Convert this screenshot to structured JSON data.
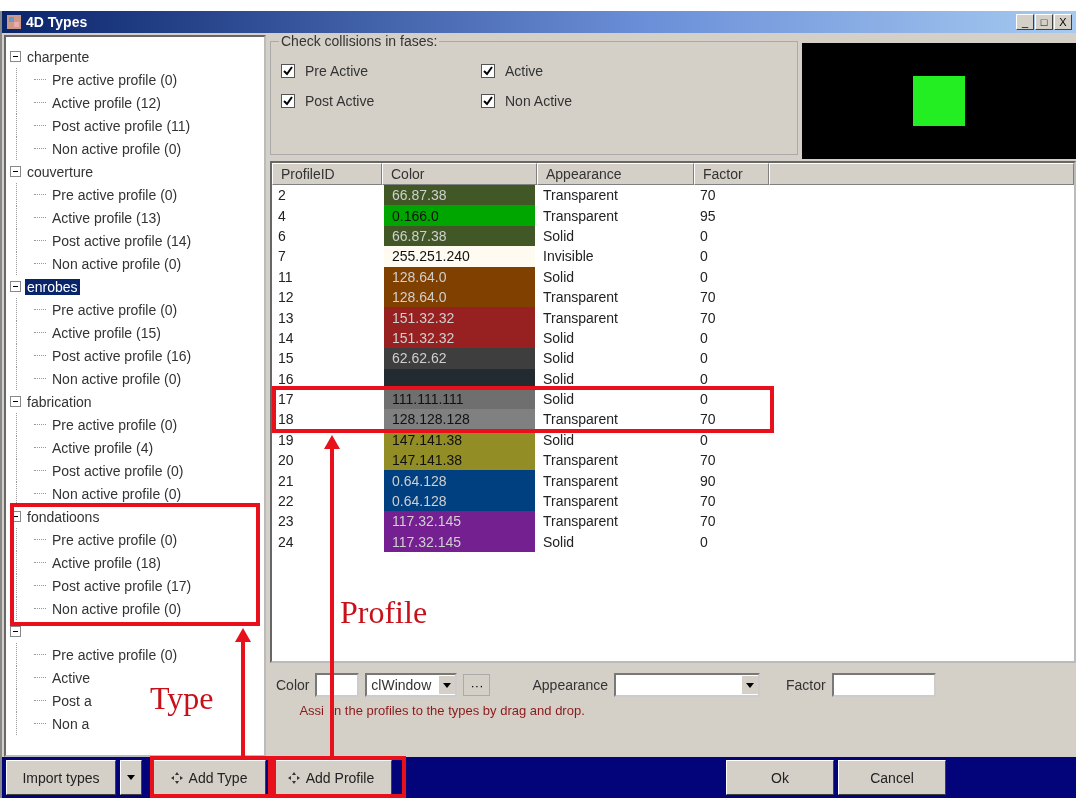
{
  "window": {
    "title": "4D Types",
    "controls": [
      "_",
      "□",
      "X"
    ]
  },
  "tree": [
    {
      "label": "charpente",
      "expanded": true,
      "selected": false,
      "children": [
        {
          "label": "Pre active profile (0)"
        },
        {
          "label": "Active profile (12)"
        },
        {
          "label": "Post active profile (11)"
        },
        {
          "label": "Non active profile (0)"
        }
      ]
    },
    {
      "label": "couverture",
      "expanded": true,
      "selected": false,
      "children": [
        {
          "label": "Pre active profile (0)"
        },
        {
          "label": "Active profile (13)"
        },
        {
          "label": "Post active profile (14)"
        },
        {
          "label": "Non active profile (0)"
        }
      ]
    },
    {
      "label": "enrobes",
      "expanded": true,
      "selected": true,
      "children": [
        {
          "label": "Pre active profile (0)"
        },
        {
          "label": "Active profile (15)"
        },
        {
          "label": "Post active profile (16)"
        },
        {
          "label": "Non active profile (0)"
        }
      ]
    },
    {
      "label": "fabrication",
      "expanded": true,
      "selected": false,
      "children": [
        {
          "label": "Pre active profile (0)"
        },
        {
          "label": "Active profile (4)"
        },
        {
          "label": "Post active profile (0)"
        },
        {
          "label": "Non active profile (0)"
        }
      ]
    },
    {
      "label": "fondatioons",
      "expanded": true,
      "selected": false,
      "children": [
        {
          "label": "Pre active profile (0)"
        },
        {
          "label": "Active profile (18)"
        },
        {
          "label": "Post active profile (17)"
        },
        {
          "label": "Non active profile (0)"
        }
      ]
    },
    {
      "expanded": true,
      "children": [
        {
          "label": "Pre active profile (0)"
        },
        {
          "label": "Active"
        },
        {
          "label": "Post a"
        },
        {
          "label": "Non a"
        }
      ]
    }
  ],
  "collisions": {
    "title": "Check collisions in fases:",
    "options": [
      {
        "label": "Pre Active",
        "checked": true
      },
      {
        "label": "Active",
        "checked": true
      },
      {
        "label": "Post Active",
        "checked": true
      },
      {
        "label": "Non Active",
        "checked": true
      }
    ]
  },
  "preview": {
    "color": "#22ee22"
  },
  "table": {
    "columns": [
      "ProfileID",
      "Color",
      "Appearance",
      "Factor"
    ],
    "rows": [
      {
        "id": "2",
        "color": "#425726",
        "color_text": "66.87.38",
        "appearance": "Transparent",
        "factor": "70"
      },
      {
        "id": "4",
        "color": "#00a600",
        "color_text": "0.166.0",
        "appearance": "Transparent",
        "factor": "95"
      },
      {
        "id": "6",
        "color": "#425726",
        "color_text": "66.87.38",
        "appearance": "Solid",
        "factor": "0"
      },
      {
        "id": "7",
        "color": "#fffbf0",
        "color_text": "255.251.240",
        "appearance": "Invisible",
        "factor": "0"
      },
      {
        "id": "11",
        "color": "#804000",
        "color_text": "128.64.0",
        "appearance": "Solid",
        "factor": "0"
      },
      {
        "id": "12",
        "color": "#804000",
        "color_text": "128.64.0",
        "appearance": "Transparent",
        "factor": "70"
      },
      {
        "id": "13",
        "color": "#972020",
        "color_text": "151.32.32",
        "appearance": "Transparent",
        "factor": "70"
      },
      {
        "id": "14",
        "color": "#972020",
        "color_text": "151.32.32",
        "appearance": "Solid",
        "factor": "0"
      },
      {
        "id": "15",
        "color": "#3e3e3e",
        "color_text": "62.62.62",
        "appearance": "Solid",
        "factor": "0"
      },
      {
        "id": "16",
        "color": "#232a30",
        "appearance": "Solid",
        "factor": "0"
      },
      {
        "id": "17",
        "color": "#6f6f6f",
        "color_text": "111.111.111",
        "appearance": "Solid",
        "factor": "0"
      },
      {
        "id": "18",
        "color": "#808080",
        "color_text": "128.128.128",
        "appearance": "Transparent",
        "factor": "70"
      },
      {
        "id": "19",
        "color": "#938d26",
        "color_text": "147.141.38",
        "appearance": "Solid",
        "factor": "0"
      },
      {
        "id": "20",
        "color": "#938d26",
        "color_text": "147.141.38",
        "appearance": "Transparent",
        "factor": "70"
      },
      {
        "id": "21",
        "color": "#004080",
        "color_text": "0.64.128",
        "appearance": "Transparent",
        "factor": "90"
      },
      {
        "id": "22",
        "color": "#004080",
        "color_text": "0.64.128",
        "appearance": "Transparent",
        "factor": "70"
      },
      {
        "id": "23",
        "color": "#752091",
        "color_text": "117.32.145",
        "appearance": "Transparent",
        "factor": "70"
      },
      {
        "id": "24",
        "color": "#752091",
        "color_text": "117.32.145",
        "appearance": "Solid",
        "factor": "0"
      }
    ]
  },
  "editor": {
    "color_label": "Color",
    "color_value": "clWindow",
    "more": "···",
    "appearance_label": "Appearance",
    "factor_label": "Factor",
    "hint": [
      "Assi",
      "n the profiles to the types by drag and drop."
    ]
  },
  "buttons": {
    "import": "Import types",
    "add_type": "Add Type",
    "add_profile": "Add Profile",
    "ok": "Ok",
    "cancel": "Cancel"
  },
  "annotations": [
    {
      "text": "Type"
    },
    {
      "text": "Profile"
    }
  ]
}
